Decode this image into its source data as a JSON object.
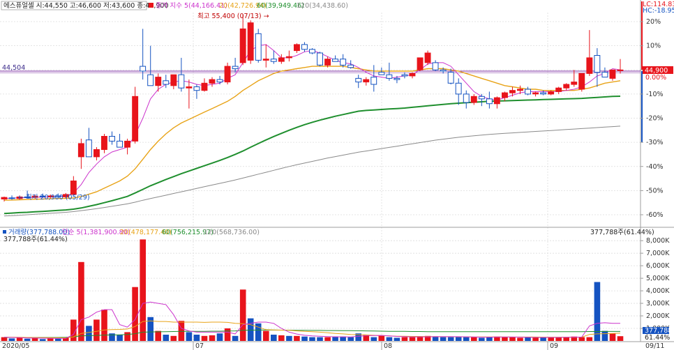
{
  "price_panel": {
    "header": {
      "stock_info": "에스퓨얼셀 시:44,550 고:46,600 저:43,600 종:44,900",
      "ma_title": "종가 지수 5(44,166.41)",
      "ma20": "20(42,726.94)",
      "ma60": "60(39,949.46)",
      "ma120": "120(34,438.60)"
    },
    "lc_label": "LC:114.83",
    "hc_label": "HC:-18.95",
    "ref_line_label": "44,504",
    "current_price_label": "44,900",
    "current_pct_label": "0.00%",
    "high_annotation": "최고 55,400 (07/13) →",
    "low_annotation": "← 최저 20,900 (05/29)",
    "y_ticks": [
      "20%",
      "10%",
      "0.00%",
      "-10%",
      "-20%",
      "-30%",
      "-40%",
      "-50%",
      "-60%"
    ]
  },
  "volume_panel": {
    "header": {
      "title": "거래량(377,788.00)",
      "ma5": "단순 5(1,381,900.80)",
      "ma20": "20(478,177.40)",
      "ma60": "60(756,215.97)",
      "ma120": "120(568,736.00)"
    },
    "left_value_label": "377,788주(61.44%)",
    "right_value_label": "377,788주(61.44%)",
    "y_ticks": [
      "8,000K",
      "7,000K",
      "6,000K",
      "5,000K",
      "4,000K",
      "3,000K",
      "2,000K",
      "1,000K"
    ],
    "current_volume_label": "377,788",
    "current_pct_label": "61.44%"
  },
  "x_axis": {
    "labels": [
      "2020/05",
      "07",
      "08",
      "09",
      "09/11"
    ]
  },
  "colors": {
    "up": "#e8141b",
    "down": "#1553c1",
    "ma5": "#cc33cc",
    "ma20": "#e8a317",
    "ma60": "#1f8f2e",
    "ma120": "#8a8a8a",
    "grid": "#dcdcdc",
    "ref_line": "#7a2aa0"
  },
  "chart_data": {
    "type": "candlestick",
    "title": "에스퓨얼셀",
    "y_unit": "% from reference",
    "ylim": [
      -63,
      23
    ],
    "candles": [
      {
        "o": -53.5,
        "h": -52.5,
        "l": -54.5,
        "c": -52.8
      },
      {
        "o": -53.0,
        "h": -52.0,
        "l": -53.8,
        "c": -53.3
      },
      {
        "o": -53.3,
        "h": -52.0,
        "l": -53.8,
        "c": -52.6
      },
      {
        "o": -52.6,
        "h": -50.0,
        "l": -53.2,
        "c": -52.8
      },
      {
        "o": -52.8,
        "h": -51.8,
        "l": -53.4,
        "c": -52.3
      },
      {
        "o": -52.3,
        "h": -51.2,
        "l": -53.0,
        "c": -52.6
      },
      {
        "o": -52.6,
        "h": -51.6,
        "l": -53.3,
        "c": -52.2
      },
      {
        "o": -52.2,
        "h": -51.2,
        "l": -52.9,
        "c": -52.6
      },
      {
        "o": -52.6,
        "h": -51.0,
        "l": -53.2,
        "c": -51.6
      },
      {
        "o": -51.6,
        "h": -44.0,
        "l": -52.0,
        "c": -46.0
      },
      {
        "o": -36.0,
        "h": -28.5,
        "l": -41.0,
        "c": -30.5
      },
      {
        "o": -29.0,
        "h": -24.0,
        "l": -32.0,
        "c": -36.0
      },
      {
        "o": -36.0,
        "h": -32.0,
        "l": -37.5,
        "c": -33.0
      },
      {
        "o": -33.0,
        "h": -26.5,
        "l": -34.5,
        "c": -27.5
      },
      {
        "o": -27.5,
        "h": -25.5,
        "l": -31.0,
        "c": -29.5
      },
      {
        "o": -29.5,
        "h": -26.5,
        "l": -32.0,
        "c": -32.0
      },
      {
        "o": -32.0,
        "h": -28.5,
        "l": -35.0,
        "c": -29.5
      },
      {
        "o": -29.5,
        "h": -7.0,
        "l": -30.5,
        "c": -11.0
      },
      {
        "o": 1.5,
        "h": 17.0,
        "l": -4.0,
        "c": -0.5
      },
      {
        "o": -2.0,
        "h": 10.0,
        "l": -5.0,
        "c": -6.5
      },
      {
        "o": -6.5,
        "h": -1.5,
        "l": -9.0,
        "c": -3.0
      },
      {
        "o": -4.5,
        "h": -2.0,
        "l": -7.5,
        "c": -6.0
      },
      {
        "o": -6.5,
        "h": -2.0,
        "l": -8.0,
        "c": -2.0
      },
      {
        "o": -2.0,
        "h": 5.0,
        "l": -9.0,
        "c": -7.5
      },
      {
        "o": -7.5,
        "h": -4.0,
        "l": -16.0,
        "c": -7.0
      },
      {
        "o": -7.0,
        "h": -6.0,
        "l": -12.0,
        "c": -8.5
      },
      {
        "o": -8.5,
        "h": -3.5,
        "l": -9.0,
        "c": -5.5
      },
      {
        "o": -5.5,
        "h": -3.0,
        "l": -7.0,
        "c": -4.0
      },
      {
        "o": -4.0,
        "h": -2.5,
        "l": -6.0,
        "c": -5.0
      },
      {
        "o": -5.0,
        "h": 3.0,
        "l": -6.0,
        "c": 1.5
      },
      {
        "o": 1.5,
        "h": 5.0,
        "l": -1.0,
        "c": 0.5
      },
      {
        "o": 3.0,
        "h": 23.0,
        "l": 2.0,
        "c": 17.0
      },
      {
        "o": 4.0,
        "h": 20.5,
        "l": 2.5,
        "c": 19.5
      },
      {
        "o": 15.0,
        "h": 17.0,
        "l": 3.0,
        "c": 4.0
      },
      {
        "o": 4.0,
        "h": 10.5,
        "l": 1.0,
        "c": 4.5
      },
      {
        "o": 4.5,
        "h": 8.0,
        "l": 2.5,
        "c": 3.5
      },
      {
        "o": 3.5,
        "h": 6.5,
        "l": 2.5,
        "c": 5.0
      },
      {
        "o": 5.0,
        "h": 8.0,
        "l": 3.5,
        "c": 5.5
      },
      {
        "o": 8.0,
        "h": 11.0,
        "l": 7.0,
        "c": 10.5
      },
      {
        "o": 10.5,
        "h": 11.5,
        "l": 7.5,
        "c": 8.5
      },
      {
        "o": 8.5,
        "h": 9.0,
        "l": 6.5,
        "c": 7.0
      },
      {
        "o": 7.0,
        "h": 7.5,
        "l": 1.5,
        "c": 2.0
      },
      {
        "o": 2.0,
        "h": 5.5,
        "l": 1.0,
        "c": 4.5
      },
      {
        "o": 4.5,
        "h": 6.0,
        "l": 3.5,
        "c": 3.5
      },
      {
        "o": 4.5,
        "h": 6.5,
        "l": 1.0,
        "c": 2.0
      },
      {
        "o": 2.0,
        "h": 4.0,
        "l": 0.5,
        "c": 1.0
      },
      {
        "o": -3.5,
        "h": -2.0,
        "l": -7.5,
        "c": -5.0
      },
      {
        "o": -5.0,
        "h": -3.0,
        "l": -6.5,
        "c": -4.0
      },
      {
        "o": -3.0,
        "h": 2.0,
        "l": -9.0,
        "c": -6.0
      },
      {
        "o": -1.0,
        "h": 1.0,
        "l": -2.0,
        "c": -2.0
      },
      {
        "o": -2.0,
        "h": 3.0,
        "l": -4.5,
        "c": -3.5
      },
      {
        "o": -3.5,
        "h": -2.5,
        "l": -5.5,
        "c": -4.0
      },
      {
        "o": -2.0,
        "h": -1.0,
        "l": -3.5,
        "c": -2.5
      },
      {
        "o": -2.5,
        "h": -1.0,
        "l": -3.5,
        "c": -1.5
      },
      {
        "o": 0.0,
        "h": 5.0,
        "l": -0.5,
        "c": 5.0
      },
      {
        "o": 3.0,
        "h": 8.0,
        "l": 2.0,
        "c": 7.0
      },
      {
        "o": 3.0,
        "h": 4.0,
        "l": -0.5,
        "c": 0.0
      },
      {
        "o": 0.0,
        "h": 1.0,
        "l": -1.5,
        "c": -0.5
      },
      {
        "o": -1.0,
        "h": 0.5,
        "l": -6.0,
        "c": -5.5
      },
      {
        "o": -5.5,
        "h": -3.5,
        "l": -14.5,
        "c": -10.0
      },
      {
        "o": -10.0,
        "h": -8.5,
        "l": -16.0,
        "c": -13.5
      },
      {
        "o": -13.5,
        "h": -10.0,
        "l": -14.5,
        "c": -11.0
      },
      {
        "o": -11.0,
        "h": -10.0,
        "l": -15.0,
        "c": -12.0
      },
      {
        "o": -12.0,
        "h": -9.0,
        "l": -16.0,
        "c": -14.0
      },
      {
        "o": -14.0,
        "h": -11.0,
        "l": -16.0,
        "c": -11.5
      },
      {
        "o": -11.5,
        "h": -9.0,
        "l": -13.0,
        "c": -9.5
      },
      {
        "o": -9.5,
        "h": -7.0,
        "l": -11.0,
        "c": -8.5
      },
      {
        "o": -8.5,
        "h": -6.5,
        "l": -10.0,
        "c": -8.0
      },
      {
        "o": -8.0,
        "h": -7.0,
        "l": -10.5,
        "c": -10.0
      },
      {
        "o": -10.0,
        "h": -9.0,
        "l": -11.0,
        "c": -9.5
      },
      {
        "o": -9.5,
        "h": -8.5,
        "l": -10.5,
        "c": -10.0
      },
      {
        "o": -10.0,
        "h": -8.5,
        "l": -10.5,
        "c": -9.0
      },
      {
        "o": -9.0,
        "h": -7.0,
        "l": -10.0,
        "c": -7.5
      },
      {
        "o": -7.5,
        "h": -5.5,
        "l": -8.5,
        "c": -6.0
      },
      {
        "o": -6.0,
        "h": 0.0,
        "l": -7.0,
        "c": -5.0
      },
      {
        "o": -8.0,
        "h": -4.5,
        "l": -9.0,
        "c": -1.5
      },
      {
        "o": -1.5,
        "h": 16.5,
        "l": -2.5,
        "c": 5.0
      },
      {
        "o": 6.0,
        "h": 9.0,
        "l": -7.0,
        "c": -1.0
      },
      {
        "o": -1.0,
        "h": 1.0,
        "l": -2.5,
        "c": -3.0
      },
      {
        "o": -3.5,
        "h": -2.0,
        "l": -4.5,
        "c": 0.0
      },
      {
        "o": 0.0,
        "h": 4.5,
        "l": -1.5,
        "c": 0.0
      }
    ],
    "ma5": [
      -53.3,
      -53.1,
      -53.0,
      -52.9,
      -52.8,
      -52.7,
      -52.6,
      -52.5,
      -52.3,
      -51.0,
      -47.5,
      -42.5,
      -39.0,
      -36.0,
      -34.0,
      -33.0,
      -32.0,
      -27.0,
      -20.0,
      -12.0,
      -8.0,
      -6.0,
      -5.0,
      -4.5,
      -5.0,
      -6.0,
      -6.5,
      -6.0,
      -5.5,
      -3.5,
      -2.0,
      3.0,
      8.0,
      10.0,
      10.5,
      8.0,
      5.0,
      5.0,
      6.0,
      7.5,
      8.0,
      7.0,
      5.5,
      4.0,
      3.0,
      2.5,
      1.0,
      -1.0,
      -2.5,
      -3.0,
      -3.5,
      -3.0,
      -2.5,
      -2.0,
      0.0,
      2.5,
      3.0,
      3.0,
      1.5,
      -2.0,
      -5.5,
      -9.0,
      -11.0,
      -12.0,
      -12.5,
      -11.5,
      -10.5,
      -9.5,
      -9.0,
      -9.0,
      -9.0,
      -9.0,
      -9.0,
      -8.5,
      -8.0,
      -7.0,
      -5.0,
      -2.5,
      -1.5,
      0.5,
      0.0
    ],
    "ma20": [
      -54.0,
      -53.9,
      -53.8,
      -53.7,
      -53.6,
      -53.5,
      -53.4,
      -53.3,
      -53.2,
      -53.0,
      -52.5,
      -51.5,
      -50.5,
      -49.0,
      -47.5,
      -46.0,
      -44.0,
      -41.0,
      -37.0,
      -33.0,
      -29.5,
      -26.5,
      -24.0,
      -22.0,
      -20.5,
      -19.0,
      -17.5,
      -16.0,
      -14.5,
      -13.0,
      -11.0,
      -8.5,
      -6.5,
      -4.5,
      -3.0,
      -1.5,
      -0.5,
      0.0,
      0.5,
      1.0,
      1.5,
      1.5,
      1.5,
      1.5,
      1.5,
      1.0,
      0.5,
      0.0,
      -0.5,
      -0.5,
      -0.5,
      -0.5,
      -0.5,
      -0.5,
      0.0,
      0.5,
      0.5,
      0.5,
      0.0,
      -0.5,
      -1.5,
      -2.5,
      -3.5,
      -4.5,
      -5.5,
      -6.5,
      -7.0,
      -7.5,
      -8.0,
      -8.0,
      -8.5,
      -8.5,
      -8.5,
      -8.5,
      -8.5,
      -8.0,
      -7.5,
      -6.5,
      -5.5,
      -5.0,
      -4.5
    ],
    "ma60": [
      -59.5,
      -59.3,
      -59.1,
      -59.0,
      -58.8,
      -58.6,
      -58.4,
      -58.2,
      -58.0,
      -57.7,
      -57.2,
      -56.5,
      -55.8,
      -55.0,
      -54.2,
      -53.3,
      -52.4,
      -51.0,
      -49.5,
      -48.0,
      -46.7,
      -45.4,
      -44.2,
      -43.0,
      -41.9,
      -40.8,
      -39.7,
      -38.6,
      -37.5,
      -36.3,
      -35.0,
      -33.6,
      -32.0,
      -30.5,
      -29.0,
      -27.6,
      -26.3,
      -25.0,
      -23.8,
      -22.7,
      -21.7,
      -20.8,
      -20.0,
      -19.2,
      -18.5,
      -17.8,
      -17.1,
      -16.8,
      -16.6,
      -16.4,
      -16.2,
      -16.0,
      -15.8,
      -15.5,
      -15.2,
      -14.9,
      -14.6,
      -14.3,
      -14.0,
      -13.8,
      -13.6,
      -13.4,
      -13.2,
      -13.0,
      -12.9,
      -12.8,
      -12.7,
      -12.6,
      -12.5,
      -12.4,
      -12.3,
      -12.2,
      -12.1,
      -12.0,
      -11.9,
      -11.8,
      -11.6,
      -11.4,
      -11.2,
      -11.0,
      -10.9
    ],
    "ma120": [
      -60.5,
      -60.4,
      -60.2,
      -60.0,
      -59.8,
      -59.6,
      -59.4,
      -59.2,
      -59.0,
      -58.7,
      -58.3,
      -57.9,
      -57.5,
      -57.0,
      -56.5,
      -56.0,
      -55.5,
      -54.8,
      -54.0,
      -53.3,
      -52.6,
      -51.9,
      -51.2,
      -50.5,
      -49.8,
      -49.1,
      -48.4,
      -47.7,
      -47.0,
      -46.3,
      -45.6,
      -44.8,
      -44.0,
      -43.2,
      -42.4,
      -41.6,
      -40.8,
      -40.0,
      -39.3,
      -38.6,
      -37.9,
      -37.2,
      -36.5,
      -35.9,
      -35.3,
      -34.7,
      -34.1,
      -33.6,
      -33.1,
      -32.6,
      -32.1,
      -31.6,
      -31.1,
      -30.6,
      -30.1,
      -29.6,
      -29.1,
      -28.7,
      -28.3,
      -27.9,
      -27.6,
      -27.3,
      -27.0,
      -26.7,
      -26.5,
      -26.3,
      -26.1,
      -25.9,
      -25.7,
      -25.5,
      -25.3,
      -25.1,
      -24.9,
      -24.7,
      -24.5,
      -24.3,
      -24.1,
      -23.9,
      -23.7,
      -23.5,
      -23.3
    ],
    "volume_k": [
      300,
      200,
      250,
      180,
      220,
      150,
      200,
      180,
      250,
      1700,
      6300,
      1200,
      1700,
      2500,
      600,
      500,
      700,
      4300,
      8100,
      1900,
      800,
      500,
      400,
      1600,
      700,
      500,
      400,
      450,
      600,
      1000,
      400,
      4100,
      1800,
      1400,
      800,
      500,
      450,
      400,
      400,
      350,
      300,
      300,
      300,
      350,
      350,
      300,
      600,
      500,
      300,
      450,
      300,
      250,
      300,
      300,
      350,
      400,
      350,
      300,
      300,
      350,
      300,
      300,
      250,
      300,
      350,
      300,
      300,
      250,
      300,
      250,
      300,
      250,
      300,
      300,
      350,
      300,
      300,
      4700,
      800,
      600,
      380
    ],
    "volume_up": [
      true,
      false,
      true,
      false,
      true,
      false,
      true,
      false,
      true,
      true,
      true,
      false,
      true,
      true,
      false,
      false,
      true,
      true,
      true,
      false,
      true,
      false,
      true,
      true,
      false,
      false,
      true,
      true,
      false,
      true,
      false,
      true,
      false,
      false,
      true,
      false,
      true,
      false,
      true,
      false,
      false,
      false,
      true,
      false,
      false,
      false,
      false,
      true,
      false,
      true,
      false,
      false,
      true,
      true,
      true,
      true,
      false,
      false,
      false,
      false,
      false,
      true,
      false,
      false,
      true,
      true,
      true,
      true,
      false,
      true,
      false,
      true,
      true,
      true,
      true,
      true,
      true,
      false,
      false,
      true,
      true
    ],
    "vol_ma5_k": [
      300,
      280,
      260,
      240,
      230,
      220,
      210,
      200,
      210,
      520,
      1700,
      1900,
      2300,
      2500,
      2500,
      1300,
      1100,
      1700,
      3000,
      3100,
      3000,
      2900,
      2100,
      1000,
      800,
      700,
      700,
      700,
      700,
      700,
      560,
      1300,
      1400,
      1500,
      1500,
      1400,
      1000,
      700,
      550,
      450,
      400,
      370,
      350,
      330,
      330,
      320,
      360,
      420,
      430,
      440,
      400,
      360,
      340,
      320,
      330,
      330,
      340,
      340,
      340,
      340,
      330,
      310,
      300,
      300,
      310,
      310,
      310,
      300,
      290,
      280,
      280,
      280,
      280,
      290,
      300,
      310,
      1200,
      1400,
      1450,
      1400,
      1400
    ],
    "vol_ma20_k": [
      300,
      300,
      290,
      280,
      270,
      260,
      255,
      250,
      250,
      320,
      600,
      680,
      760,
      880,
      900,
      920,
      950,
      1150,
      1550,
      1600,
      1550,
      1550,
      1500,
      1500,
      1500,
      1500,
      1480,
      1500,
      1500,
      1480,
      1400,
      1380,
      1300,
      1100,
      900,
      880,
      860,
      850,
      800,
      760,
      740,
      700,
      650,
      600,
      560,
      520,
      500,
      480,
      450,
      420,
      400,
      380,
      370,
      360,
      360,
      350,
      350,
      340,
      340,
      330,
      330,
      320,
      320,
      320,
      320,
      320,
      310,
      310,
      310,
      310,
      300,
      300,
      300,
      300,
      300,
      300,
      520,
      560,
      580,
      600,
      620
    ],
    "vol_ma60_k": [
      280,
      280,
      280,
      280,
      280,
      280,
      280,
      280,
      290,
      320,
      400,
      420,
      440,
      470,
      480,
      490,
      510,
      580,
      700,
      720,
      730,
      740,
      750,
      760,
      760,
      770,
      770,
      780,
      780,
      790,
      800,
      850,
      860,
      870,
      870,
      870,
      860,
      860,
      850,
      850,
      840,
      840,
      830,
      830,
      820,
      820,
      810,
      800,
      790,
      780,
      770,
      760,
      760,
      750,
      750,
      740,
      740,
      740,
      740,
      740,
      740,
      740,
      740,
      740,
      740,
      740,
      740,
      740,
      740,
      740,
      740,
      740,
      740,
      740,
      740,
      740,
      750,
      750,
      755,
      756,
      756
    ],
    "vol_ylim_k": [
      0,
      8400
    ]
  }
}
